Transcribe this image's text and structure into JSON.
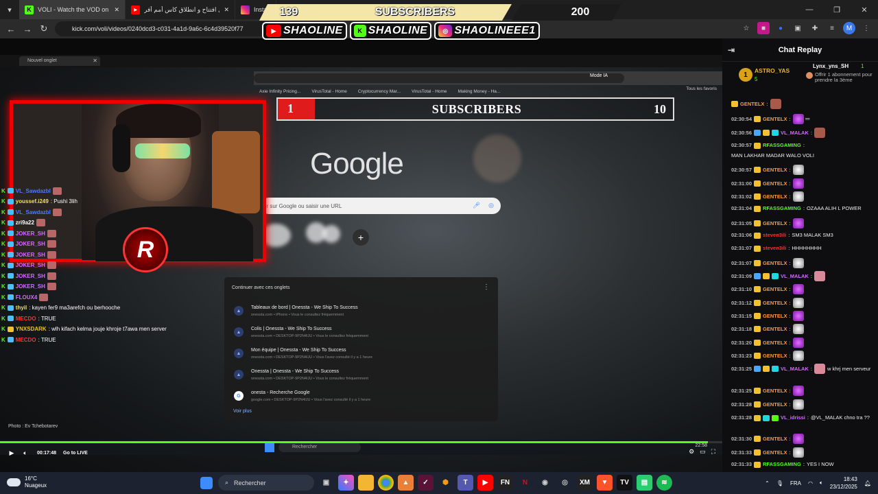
{
  "browser": {
    "tabs": [
      {
        "title": "VOLI - Watch the VOD on Ki",
        "favicon": "kick-icon"
      },
      {
        "title": "حفل افتتاح و انطلاق كاس أمم أفر",
        "favicon": "youtube-icon"
      },
      {
        "title": "Instagra",
        "favicon": "instagram-icon"
      }
    ],
    "url": "kick.com/voli/videos/0240dcd3-c031-4a1d-9a6c-6c4d39520f77"
  },
  "overlay": {
    "sub_current": "139",
    "sub_label": "SUBSCRIBERS",
    "sub_goal": "200",
    "socials": [
      {
        "platform": "youtube",
        "name": "SHAOLINE"
      },
      {
        "platform": "kick",
        "name": "SHAOLINE"
      },
      {
        "platform": "instagram",
        "name": "SHAOLINEEE1"
      }
    ]
  },
  "stream_screen": {
    "new_tab_label": "Nouvel onglet",
    "mode_ia": "Mode IA",
    "bookmarks": [
      "Axie Infinity Pricing...",
      "VirusTotal - Home",
      "Cryptocurrency Mar...",
      "VirusTotal - Home",
      "Making Money - Ha..."
    ],
    "bookmarks_right": "Tous les favoris",
    "sub_current": "1",
    "sub_label": "SUBSCRIBERS",
    "sub_goal": "10",
    "google_logo": "Google",
    "search_placeholder": "er sur Google ou saisir une URL",
    "continue_title": "Continuer avec ces onglets",
    "continue_items": [
      {
        "title": "Tableaux de bord | Onessta - We Ship To Success",
        "sub": "onessta.com • iPhone • Vous le consultez fréquemment"
      },
      {
        "title": "Colis | Onessta - We Ship To Success",
        "sub": "onessta.com • DESKTOP-9P2N4IJU • Vous le consultez fréquemment"
      },
      {
        "title": "Mon équipe | Onessta - We Ship To Success",
        "sub": "onessta.com • DESKTOP-9P2N4IJU • Vous l'avez consulté il y a 1 heure"
      },
      {
        "title": "Onessta | Onessta - We Ship To Success",
        "sub": "onessta.com • DESKTOP-9P2N4IJU • Vous le consultez fréquemment"
      },
      {
        "title": "onesta - Recherche Google",
        "sub": "google.com • DESKTOP-9P2N4IJU • Vous l'avez consulté il y a 1 heure"
      }
    ],
    "continue_more": "Voir plus",
    "photo_credit": "Photo : Ev Tchebotarev",
    "inner_search": "Rechercher",
    "inner_clock": "22:58"
  },
  "overlay_chat": [
    {
      "user": "VL_Sawdazbl",
      "color": "#4a7cff",
      "text": ""
    },
    {
      "user": "youssef.i249",
      "color": "#f0e060",
      "text": ": Pushi 3lih"
    },
    {
      "user": "VL_Sawdazbl",
      "color": "#4a7cff",
      "text": ""
    },
    {
      "user": "zri9a22",
      "color": "#ffffff",
      "text": ""
    },
    {
      "user": "JOKER_SH",
      "color": "#d26cff",
      "text": ""
    },
    {
      "user": "JOKER_SH",
      "color": "#d26cff",
      "text": ""
    },
    {
      "user": "JOKER_SH",
      "color": "#d26cff",
      "text": ""
    },
    {
      "user": "JOKER_SH",
      "color": "#d26cff",
      "text": ""
    },
    {
      "user": "JOKER_SH",
      "color": "#d26cff",
      "text": ""
    },
    {
      "user": "JOKER_SH",
      "color": "#d26cff",
      "text": ""
    },
    {
      "user": "FLOUX4",
      "color": "#d26cff",
      "text": ""
    },
    {
      "user": "thyil",
      "color": "#f0e060",
      "text": ": kayen fer9 ma3arefch ou berhooche"
    },
    {
      "user": "MECDO",
      "color": "#ff3030",
      "text": ": TRUE"
    },
    {
      "user": "YNXSDARK",
      "color": "#f0c020",
      "text": ": wlh kifach kelma jouje khroje t7awa men server"
    },
    {
      "user": "MECDO",
      "color": "#ff3030",
      "text": ": TRUE"
    }
  ],
  "video_controls": {
    "time": "00:17:48",
    "live_label": "Go to LIVE",
    "progress": 0.98
  },
  "chat": {
    "title": "Chat Replay",
    "pinned": {
      "rank": "1",
      "user": "ASTRO_YAS",
      "count": "5",
      "gifter": "Lynx_yns_SH",
      "gifter_count": "1",
      "message": "Offrir 1 abonnement pour prendre la 3ème"
    },
    "messages": [
      {
        "ts": "",
        "user": "GENTELX",
        "color": "#ff9a3c",
        "text": "",
        "emote": "brown"
      },
      {
        "ts": "02:30:54",
        "user": "GENTELX",
        "color": "#ff9a3c",
        "text": "",
        "emote": "purple"
      },
      {
        "ts": "02:30:56",
        "user": "VL_MALAK",
        "color": "#d26cff",
        "text": "",
        "emote": "brown"
      },
      {
        "ts": "02:30:57",
        "user": "RFASSGAMING",
        "color": "#53fc18",
        "text": "MAN LAKHAR MADAR WALO VOLI",
        "emote": ""
      },
      {
        "ts": "02:30:57",
        "user": "GENTELX",
        "color": "#ff9a3c",
        "text": "",
        "emote": "white"
      },
      {
        "ts": "02:31:00",
        "user": "GENTELX",
        "color": "#ff9a3c",
        "text": "",
        "emote": "purple"
      },
      {
        "ts": "02:31:02",
        "user": "GENTELX",
        "color": "#ff9a3c",
        "text": "",
        "emote": "white"
      },
      {
        "ts": "02:31:04",
        "user": "RFASSGAMING",
        "color": "#53fc18",
        "text": "OZAAA ALIH L POWER",
        "emote": ""
      },
      {
        "ts": "02:31:05",
        "user": "GENTELX",
        "color": "#ff9a3c",
        "text": "",
        "emote": "purple"
      },
      {
        "ts": "02:31:06",
        "user": "steven3ili",
        "color": "#ff3030",
        "text": "SM3 MALAK SM3",
        "emote": ""
      },
      {
        "ts": "02:31:07",
        "user": "steven3ili",
        "color": "#ff3030",
        "text": "HHHHHHHH",
        "emote": ""
      },
      {
        "ts": "02:31:07",
        "user": "GENTELX",
        "color": "#ff9a3c",
        "text": "",
        "emote": "white"
      },
      {
        "ts": "02:31:09",
        "user": "VL_MALAK",
        "color": "#d26cff",
        "text": "",
        "emote": "pink"
      },
      {
        "ts": "02:31:10",
        "user": "GENTELX",
        "color": "#ff9a3c",
        "text": "",
        "emote": "purple"
      },
      {
        "ts": "02:31:12",
        "user": "GENTELX",
        "color": "#ff9a3c",
        "text": "",
        "emote": "white"
      },
      {
        "ts": "02:31:15",
        "user": "GENTELX",
        "color": "#ff9a3c",
        "text": "",
        "emote": "purple"
      },
      {
        "ts": "02:31:18",
        "user": "GENTELX",
        "color": "#ff9a3c",
        "text": "",
        "emote": "white"
      },
      {
        "ts": "02:31:20",
        "user": "GENTELX",
        "color": "#ff9a3c",
        "text": "",
        "emote": "purple"
      },
      {
        "ts": "02:31:23",
        "user": "GENTELX",
        "color": "#ff9a3c",
        "text": "",
        "emote": "white"
      },
      {
        "ts": "02:31:25",
        "user": "VL_MALAK",
        "color": "#d26cff",
        "text": "w khrj men serveur",
        "emote": "pink"
      },
      {
        "ts": "02:31:25",
        "user": "GENTELX",
        "color": "#ff9a3c",
        "text": "",
        "emote": "purple"
      },
      {
        "ts": "02:31:28",
        "user": "GENTELX",
        "color": "#ff9a3c",
        "text": "",
        "emote": "white"
      },
      {
        "ts": "02:31:28",
        "user": "VL_idrissi",
        "color": "#d26cff",
        "text": "@VL_MALAK chno tra ??",
        "emote": ""
      },
      {
        "ts": "02:31:30",
        "user": "GENTELX",
        "color": "#ff9a3c",
        "text": "",
        "emote": "purple"
      },
      {
        "ts": "02:31:33",
        "user": "GENTELX",
        "color": "#ff9a3c",
        "text": "",
        "emote": "white"
      },
      {
        "ts": "02:31:33",
        "user": "RFASSGAMING",
        "color": "#53fc18",
        "text": "YES I NOW",
        "emote": ""
      }
    ]
  },
  "taskbar": {
    "temp": "16°C",
    "weather": "Nuageux",
    "search_label": "Rechercher",
    "lang": "FRA",
    "time": "18:43",
    "date": "23/12/2025"
  }
}
